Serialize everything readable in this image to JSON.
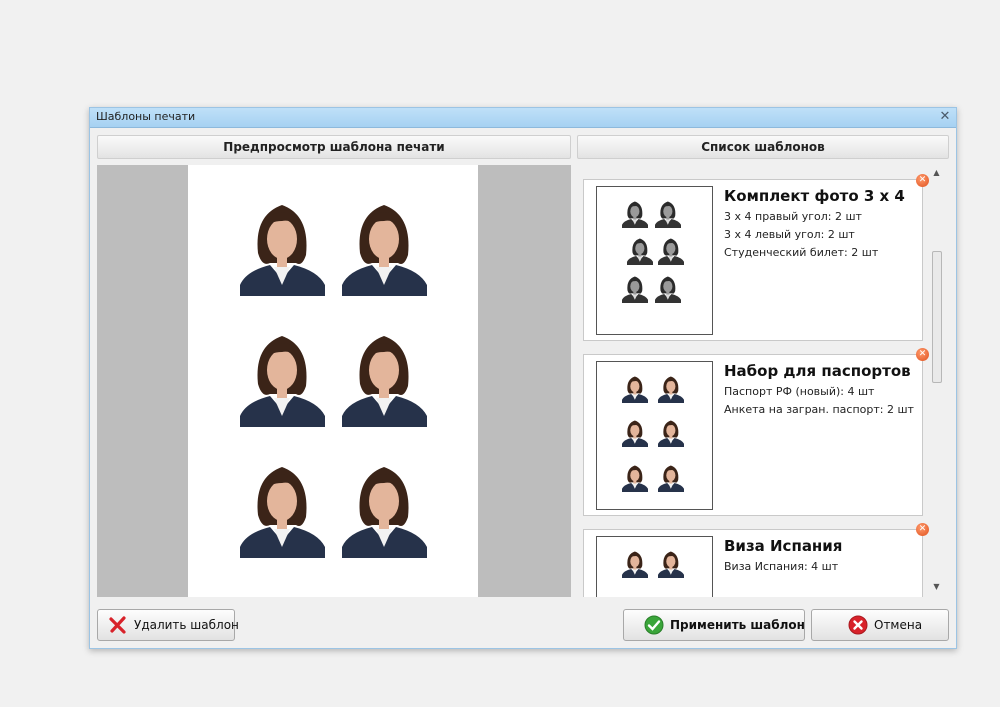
{
  "window": {
    "title": "Шаблоны печати",
    "close_icon": "close-icon"
  },
  "headers": {
    "preview": "Предпросмотр шаблона печати",
    "list": "Список шаблонов"
  },
  "templates": [
    {
      "title": "Комплект фото 3 х 4",
      "lines": [
        "3 х 4 правый угол: 2 шт",
        "3 х 4 левый угол: 2 шт",
        "Студенческий билет: 2 шт"
      ],
      "style": "grayscale"
    },
    {
      "title": "Набор для паспортов",
      "lines": [
        "Паспорт РФ (новый): 4 шт",
        "Анкета на загран. паспорт: 2 шт"
      ],
      "style": "color"
    },
    {
      "title": "Виза Испания",
      "lines": [
        "Виза Испания: 4 шт"
      ],
      "style": "color"
    }
  ],
  "buttons": {
    "delete": "Удалить шаблон",
    "apply": "Применить шаблон",
    "cancel": "Отмена"
  },
  "colors": {
    "accent": "#e0511e",
    "apply_icon": "#3aa53a",
    "cancel_icon": "#d8222a",
    "delete_icon": "#d8222a"
  }
}
